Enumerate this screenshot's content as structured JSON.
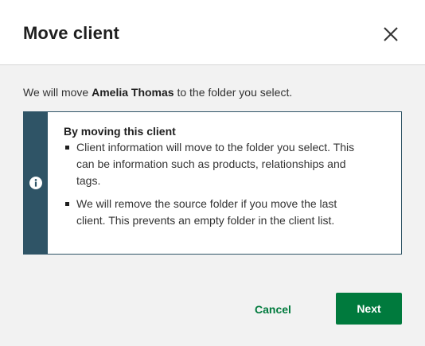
{
  "dialog": {
    "title": "Move client",
    "intro": {
      "prefix": "We will move ",
      "client_name": "Amelia Thomas",
      "suffix": " to the folder you select."
    },
    "notice": {
      "icon": "info-icon",
      "heading": "By moving this client",
      "items": [
        "Client information will move to the folder you select. This can be information such as products, relationships and tags.",
        "We will remove the source folder if you move the last client. This prevents an empty folder in the client list."
      ]
    },
    "buttons": {
      "cancel_label": "Cancel",
      "next_label": "Next"
    }
  },
  "colors": {
    "accent_green": "#007a3d",
    "notice_bar": "#2f5466",
    "background": "#f2f2f2"
  }
}
